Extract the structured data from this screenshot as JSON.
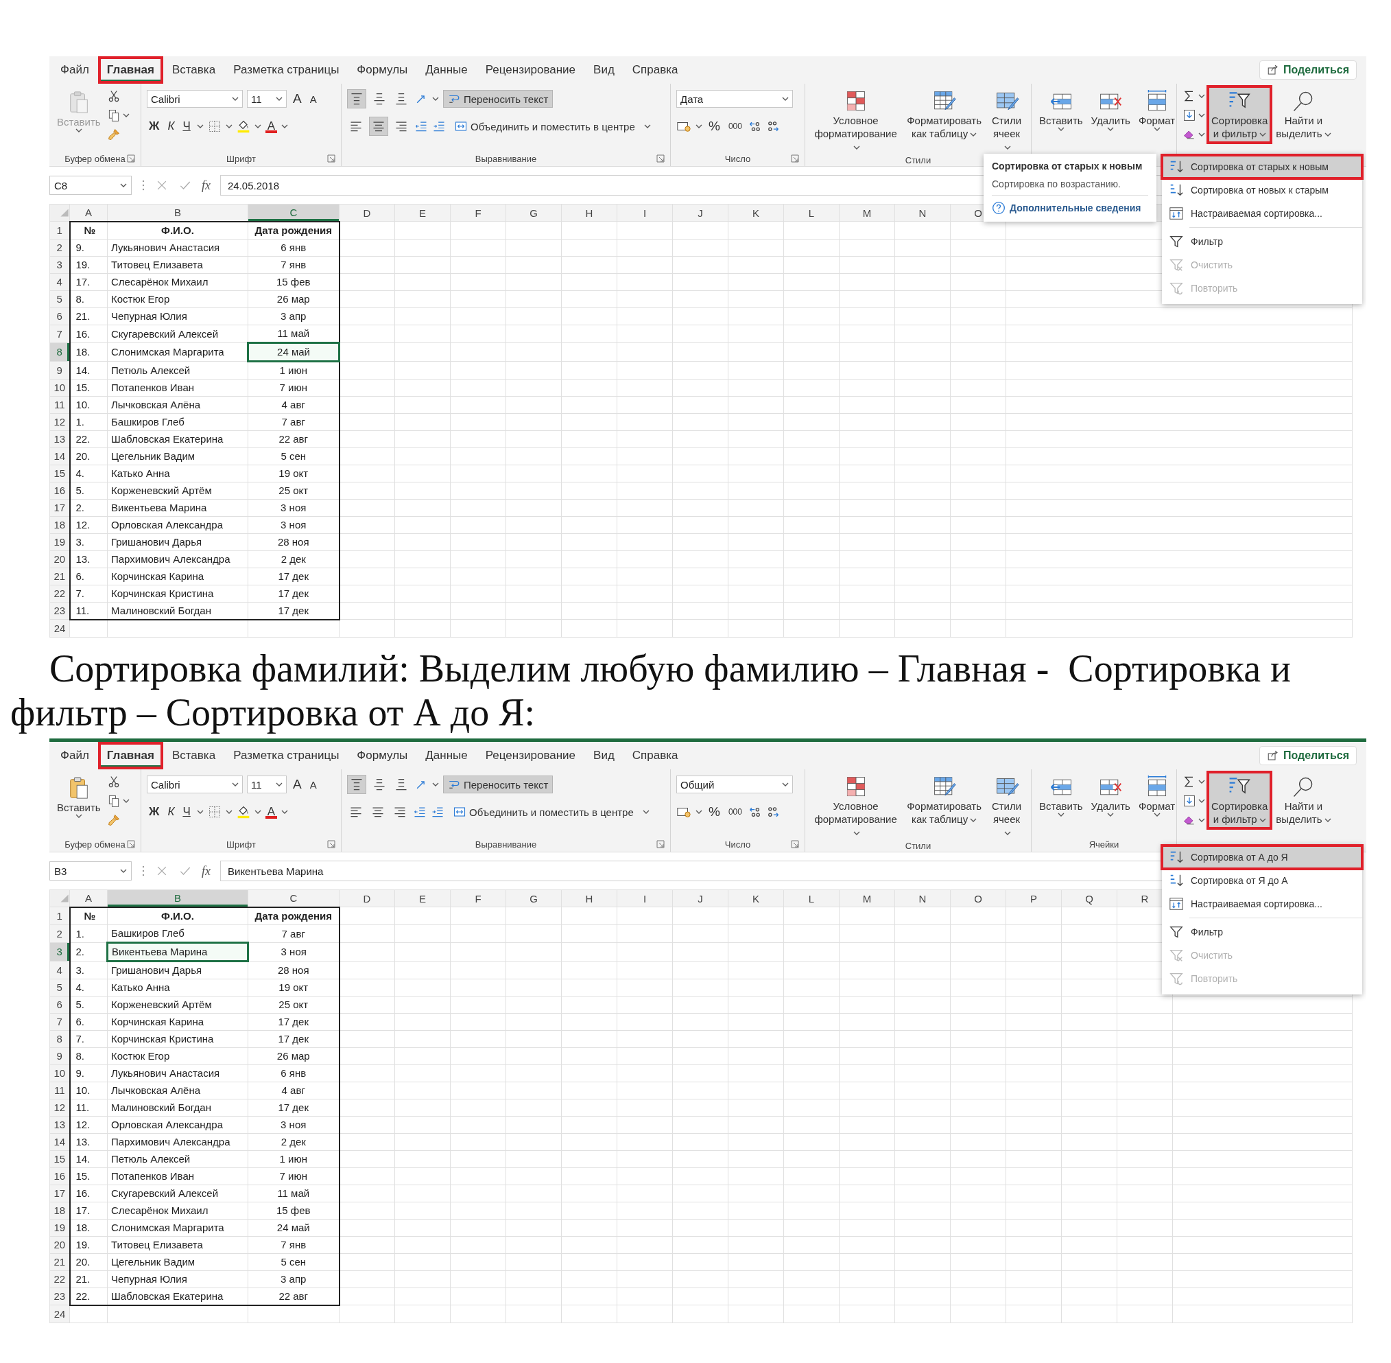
{
  "excel_top": {
    "tabs": [
      {
        "label": "Файл",
        "selected": false,
        "highlighted": false
      },
      {
        "label": "Главная",
        "selected": true,
        "highlighted": true
      },
      {
        "label": "Вставка",
        "selected": false,
        "highlighted": false
      },
      {
        "label": "Разметка страницы",
        "selected": false,
        "highlighted": false
      },
      {
        "label": "Формулы",
        "selected": false,
        "highlighted": false
      },
      {
        "label": "Данные",
        "selected": false,
        "highlighted": false
      },
      {
        "label": "Рецензирование",
        "selected": false,
        "highlighted": false
      },
      {
        "label": "Вид",
        "selected": false,
        "highlighted": false
      },
      {
        "label": "Справка",
        "selected": false,
        "highlighted": false
      }
    ],
    "share_button": "Поделиться",
    "ribbon": {
      "clipboard": {
        "paste": {
          "label": "Вставить",
          "disabled": true
        },
        "group_label": "Буфер обмена"
      },
      "font": {
        "font_name": "Calibri",
        "font_size": "11",
        "grow": "A",
        "shrink": "A",
        "bold": "Ж",
        "italic": "К",
        "underline": "Ч",
        "font_color": "A",
        "group_label": "Шрифт"
      },
      "alignment": {
        "vertical": [
          {
            "kind": "top",
            "pressed": true
          },
          {
            "kind": "middle",
            "pressed": false
          },
          {
            "kind": "bottom",
            "pressed": false
          }
        ],
        "horizontal": [
          {
            "kind": "left",
            "pressed": false
          },
          {
            "kind": "center",
            "pressed": true
          },
          {
            "kind": "right",
            "pressed": false
          }
        ],
        "wrap_text": {
          "label": "Переносить текст",
          "pressed": true
        },
        "merge": "Объединить и поместить в центре",
        "group_label": "Выравнивание"
      },
      "number": {
        "format": "Дата",
        "percent": "%",
        "thousands": "000",
        "group_label": "Число"
      },
      "styles": {
        "buttons": [
          {
            "kind": "conditional",
            "label": "Условное\nформатирование"
          },
          {
            "kind": "table",
            "label": "Форматировать\nкак таблицу"
          },
          {
            "kind": "cell-styles",
            "label": "Стили\nячеек"
          }
        ],
        "group_label": "Стили"
      },
      "cells": {
        "buttons": [
          {
            "kind": "insert",
            "label": "Вставить"
          },
          {
            "kind": "delete",
            "label": "Удалить"
          },
          {
            "kind": "format",
            "label": "Формат"
          }
        ]
      },
      "editing": {
        "sort_filter": {
          "label": "Сортировка\nи фильтр",
          "highlighted": true
        },
        "find": "Найти и\nвыделить"
      }
    },
    "formula_bar": {
      "name_box": "C8",
      "fx": "fx",
      "value": "24.05.2018"
    },
    "sheet": {
      "columns": [
        {
          "label": "A",
          "selected": false
        },
        {
          "label": "B",
          "selected": false
        },
        {
          "label": "C",
          "selected": true
        },
        {
          "label": "D",
          "selected": false
        },
        {
          "label": "E",
          "selected": false
        },
        {
          "label": "F",
          "selected": false
        },
        {
          "label": "G",
          "selected": false
        },
        {
          "label": "H",
          "selected": false
        },
        {
          "label": "I",
          "selected": false
        },
        {
          "label": "J",
          "selected": false
        },
        {
          "label": "K",
          "selected": false
        },
        {
          "label": "L",
          "selected": false
        },
        {
          "label": "M",
          "selected": false
        },
        {
          "label": "N",
          "selected": false
        },
        {
          "label": "O",
          "selected": false
        }
      ],
      "rows": [
        {
          "header": "1",
          "selected": false,
          "kind": "header",
          "cells": [
            {
              "text": "№",
              "active": false
            },
            {
              "text": "Ф.И.О.",
              "active": false
            },
            {
              "text": "Дата рождения",
              "active": false
            }
          ]
        },
        {
          "header": "2",
          "selected": false,
          "kind": "data",
          "cells": [
            {
              "text": "9.",
              "active": false
            },
            {
              "text": "Лукьянович Анастасия",
              "active": false
            },
            {
              "text": "6 янв",
              "active": false
            }
          ]
        },
        {
          "header": "3",
          "selected": false,
          "kind": "data",
          "cells": [
            {
              "text": "19.",
              "active": false
            },
            {
              "text": "Титовец Елизавета",
              "active": false
            },
            {
              "text": "7 янв",
              "active": false
            }
          ]
        },
        {
          "header": "4",
          "selected": false,
          "kind": "data",
          "cells": [
            {
              "text": "17.",
              "active": false
            },
            {
              "text": "Слесарёнок Михаил",
              "active": false
            },
            {
              "text": "15 фев",
              "active": false
            }
          ]
        },
        {
          "header": "5",
          "selected": false,
          "kind": "data",
          "cells": [
            {
              "text": "8.",
              "active": false
            },
            {
              "text": "Костюк Егор",
              "active": false
            },
            {
              "text": "26 мар",
              "active": false
            }
          ]
        },
        {
          "header": "6",
          "selected": false,
          "kind": "data",
          "cells": [
            {
              "text": "21.",
              "active": false
            },
            {
              "text": "Чепурная Юлия",
              "active": false
            },
            {
              "text": "3 апр",
              "active": false
            }
          ]
        },
        {
          "header": "7",
          "selected": false,
          "kind": "data",
          "cells": [
            {
              "text": "16.",
              "active": false
            },
            {
              "text": "Скугаревский Алексей",
              "active": false
            },
            {
              "text": "11 май",
              "active": false
            }
          ]
        },
        {
          "header": "8",
          "selected": true,
          "kind": "data",
          "cells": [
            {
              "text": "18.",
              "active": false
            },
            {
              "text": "Слонимская Маргарита",
              "active": false
            },
            {
              "text": "24 май",
              "active": true
            }
          ]
        },
        {
          "header": "9",
          "selected": false,
          "kind": "data",
          "cells": [
            {
              "text": "14.",
              "active": false
            },
            {
              "text": "Петюль Алексей",
              "active": false
            },
            {
              "text": "1 июн",
              "active": false
            }
          ]
        },
        {
          "header": "10",
          "selected": false,
          "kind": "data",
          "cells": [
            {
              "text": "15.",
              "active": false
            },
            {
              "text": "Потапенков Иван",
              "active": false
            },
            {
              "text": "7 июн",
              "active": false
            }
          ]
        },
        {
          "header": "11",
          "selected": false,
          "kind": "data",
          "cells": [
            {
              "text": "10.",
              "active": false
            },
            {
              "text": "Лычковская Алёна",
              "active": false
            },
            {
              "text": "4 авг",
              "active": false
            }
          ]
        },
        {
          "header": "12",
          "selected": false,
          "kind": "data",
          "cells": [
            {
              "text": "1.",
              "active": false
            },
            {
              "text": "Башкиров Глеб",
              "active": false
            },
            {
              "text": "7 авг",
              "active": false
            }
          ]
        },
        {
          "header": "13",
          "selected": false,
          "kind": "data",
          "cells": [
            {
              "text": "22.",
              "active": false
            },
            {
              "text": "Шабловская Екатерина",
              "active": false
            },
            {
              "text": "22 авг",
              "active": false
            }
          ]
        },
        {
          "header": "14",
          "selected": false,
          "kind": "data",
          "cells": [
            {
              "text": "20.",
              "active": false
            },
            {
              "text": "Цегельник Вадим",
              "active": false
            },
            {
              "text": "5 сен",
              "active": false
            }
          ]
        },
        {
          "header": "15",
          "selected": false,
          "kind": "data",
          "cells": [
            {
              "text": "4.",
              "active": false
            },
            {
              "text": "Катько Анна",
              "active": false
            },
            {
              "text": "19 окт",
              "active": false
            }
          ]
        },
        {
          "header": "16",
          "selected": false,
          "kind": "data",
          "cells": [
            {
              "text": "5.",
              "active": false
            },
            {
              "text": "Корженевский Артём",
              "active": false
            },
            {
              "text": "25 окт",
              "active": false
            }
          ]
        },
        {
          "header": "17",
          "selected": false,
          "kind": "data",
          "cells": [
            {
              "text": "2.",
              "active": false
            },
            {
              "text": "Викентьева Марина",
              "active": false
            },
            {
              "text": "3 ноя",
              "active": false
            }
          ]
        },
        {
          "header": "18",
          "selected": false,
          "kind": "data",
          "cells": [
            {
              "text": "12.",
              "active": false
            },
            {
              "text": "Орловская Александра",
              "active": false
            },
            {
              "text": "3 ноя",
              "active": false
            }
          ]
        },
        {
          "header": "19",
          "selected": false,
          "kind": "data",
          "cells": [
            {
              "text": "3.",
              "active": false
            },
            {
              "text": "Гришанович Дарья",
              "active": false
            },
            {
              "text": "28 ноя",
              "active": false
            }
          ]
        },
        {
          "header": "20",
          "selected": false,
          "kind": "data",
          "cells": [
            {
              "text": "13.",
              "active": false
            },
            {
              "text": "Пархимович Александра",
              "active": false
            },
            {
              "text": "2 дек",
              "active": false
            }
          ]
        },
        {
          "header": "21",
          "selected": false,
          "kind": "data",
          "cells": [
            {
              "text": "6.",
              "active": false
            },
            {
              "text": "Корчинская Карина",
              "active": false
            },
            {
              "text": "17 дек",
              "active": false
            }
          ]
        },
        {
          "header": "22",
          "selected": false,
          "kind": "data",
          "cells": [
            {
              "text": "7.",
              "active": false
            },
            {
              "text": "Корчинская Кристина",
              "active": false
            },
            {
              "text": "17 дек",
              "active": false
            }
          ]
        },
        {
          "header": "23",
          "selected": false,
          "kind": "data",
          "cells": [
            {
              "text": "11.",
              "active": false
            },
            {
              "text": "Малиновский Богдан",
              "active": false
            },
            {
              "text": "17 дек",
              "active": false
            }
          ]
        },
        {
          "header": "24",
          "selected": false,
          "kind": "data",
          "cells": []
        }
      ]
    },
    "tooltip": {
      "title": "Сортировка от старых к новым",
      "description": "Сортировка по возрастанию.",
      "link": "Дополнительные сведения"
    },
    "sort_menu": {
      "items": [
        {
          "kind": "sort-asc",
          "label": "Сортировка от старых к новым",
          "highlighted": true,
          "disabled": false
        },
        {
          "kind": "sort-desc",
          "label": "Сортировка от новых к старым",
          "highlighted": false,
          "disabled": false
        },
        {
          "kind": "custom-sort",
          "label": "Настраиваемая сортировка...",
          "highlighted": false,
          "disabled": false
        },
        {
          "kind": "filter",
          "label": "Фильтр",
          "highlighted": false,
          "disabled": false
        },
        {
          "kind": "clear",
          "label": "Очистить",
          "highlighted": false,
          "disabled": true
        },
        {
          "kind": "reapply",
          "label": "Повторить",
          "highlighted": false,
          "disabled": true
        }
      ]
    }
  },
  "caption": "Сортировка фамилий: Выделим любую фамилию – Главная -  Сортировка и фильтр – Сортировка от А до Я:",
  "excel_bottom": {
    "tabs": [
      {
        "label": "Файл",
        "selected": false,
        "highlighted": false
      },
      {
        "label": "Главная",
        "selected": true,
        "highlighted": true
      },
      {
        "label": "Вставка",
        "selected": false,
        "highlighted": false
      },
      {
        "label": "Разметка страницы",
        "selected": false,
        "highlighted": false
      },
      {
        "label": "Формулы",
        "selected": false,
        "highlighted": false
      },
      {
        "label": "Данные",
        "selected": false,
        "highlighted": false
      },
      {
        "label": "Рецензирование",
        "selected": false,
        "highlighted": false
      },
      {
        "label": "Вид",
        "selected": false,
        "highlighted": false
      },
      {
        "label": "Справка",
        "selected": false,
        "highlighted": false
      }
    ],
    "share_button": "Поделиться",
    "ribbon": {
      "clipboard": {
        "paste": {
          "label": "Вставить",
          "disabled": false
        },
        "group_label": "Буфер обмена"
      },
      "font": {
        "font_name": "Calibri",
        "font_size": "11",
        "grow": "A",
        "shrink": "A",
        "bold": "Ж",
        "italic": "К",
        "underline": "Ч",
        "font_color": "A",
        "group_label": "Шрифт"
      },
      "alignment": {
        "vertical": [
          {
            "kind": "top",
            "pressed": true
          },
          {
            "kind": "middle",
            "pressed": false
          },
          {
            "kind": "bottom",
            "pressed": false
          }
        ],
        "horizontal": [
          {
            "kind": "left",
            "pressed": false
          },
          {
            "kind": "center",
            "pressed": false
          },
          {
            "kind": "right",
            "pressed": false
          }
        ],
        "wrap_text": {
          "label": "Переносить текст",
          "pressed": true
        },
        "merge": "Объединить и поместить в центре",
        "group_label": "Выравнивание"
      },
      "number": {
        "format": "Общий",
        "percent": "%",
        "thousands": "000",
        "group_label": "Число"
      },
      "styles": {
        "buttons": [
          {
            "kind": "conditional",
            "label": "Условное\nформатирование"
          },
          {
            "kind": "table",
            "label": "Форматировать\nкак таблицу"
          },
          {
            "kind": "cell-styles",
            "label": "Стили\nячеек"
          }
        ],
        "group_label": "Стили"
      },
      "cells": {
        "buttons": [
          {
            "kind": "insert",
            "label": "Вставить"
          },
          {
            "kind": "delete",
            "label": "Удалить"
          },
          {
            "kind": "format",
            "label": "Формат"
          }
        ],
        "group_label": "Ячейки"
      },
      "editing": {
        "sort_filter": {
          "label": "Сортировка\nи фильтр",
          "highlighted": true
        },
        "find": "Найти и\nвыделить"
      }
    },
    "formula_bar": {
      "name_box": "B3",
      "fx": "fx",
      "value": "Викентьева Марина"
    },
    "sheet": {
      "columns": [
        {
          "label": "A",
          "selected": false
        },
        {
          "label": "B",
          "selected": true
        },
        {
          "label": "C",
          "selected": false
        },
        {
          "label": "D",
          "selected": false
        },
        {
          "label": "E",
          "selected": false
        },
        {
          "label": "F",
          "selected": false
        },
        {
          "label": "G",
          "selected": false
        },
        {
          "label": "H",
          "selected": false
        },
        {
          "label": "I",
          "selected": false
        },
        {
          "label": "J",
          "selected": false
        },
        {
          "label": "K",
          "selected": false
        },
        {
          "label": "L",
          "selected": false
        },
        {
          "label": "M",
          "selected": false
        },
        {
          "label": "N",
          "selected": false
        },
        {
          "label": "O",
          "selected": false
        },
        {
          "label": "P",
          "selected": false
        },
        {
          "label": "Q",
          "selected": false
        },
        {
          "label": "R",
          "selected": false
        }
      ],
      "rows": [
        {
          "header": "1",
          "selected": false,
          "kind": "header",
          "cells": [
            {
              "text": "№",
              "active": false
            },
            {
              "text": "Ф.И.О.",
              "active": false
            },
            {
              "text": "Дата рождения",
              "active": false
            }
          ]
        },
        {
          "header": "2",
          "selected": false,
          "kind": "data",
          "cells": [
            {
              "text": "1.",
              "active": false
            },
            {
              "text": "Башкиров Глеб",
              "active": false
            },
            {
              "text": "7 авг",
              "active": false
            }
          ]
        },
        {
          "header": "3",
          "selected": true,
          "kind": "data",
          "cells": [
            {
              "text": "2.",
              "active": false
            },
            {
              "text": "Викентьева Марина",
              "active": true
            },
            {
              "text": "3 ноя",
              "active": false
            }
          ]
        },
        {
          "header": "4",
          "selected": false,
          "kind": "data",
          "cells": [
            {
              "text": "3.",
              "active": false
            },
            {
              "text": "Гришанович Дарья",
              "active": false
            },
            {
              "text": "28 ноя",
              "active": false
            }
          ]
        },
        {
          "header": "5",
          "selected": false,
          "kind": "data",
          "cells": [
            {
              "text": "4.",
              "active": false
            },
            {
              "text": "Катько Анна",
              "active": false
            },
            {
              "text": "19 окт",
              "active": false
            }
          ]
        },
        {
          "header": "6",
          "selected": false,
          "kind": "data",
          "cells": [
            {
              "text": "5.",
              "active": false
            },
            {
              "text": "Корженевский Артём",
              "active": false
            },
            {
              "text": "25 окт",
              "active": false
            }
          ]
        },
        {
          "header": "7",
          "selected": false,
          "kind": "data",
          "cells": [
            {
              "text": "6.",
              "active": false
            },
            {
              "text": "Корчинская Карина",
              "active": false
            },
            {
              "text": "17 дек",
              "active": false
            }
          ]
        },
        {
          "header": "8",
          "selected": false,
          "kind": "data",
          "cells": [
            {
              "text": "7.",
              "active": false
            },
            {
              "text": "Корчинская Кристина",
              "active": false
            },
            {
              "text": "17 дек",
              "active": false
            }
          ]
        },
        {
          "header": "9",
          "selected": false,
          "kind": "data",
          "cells": [
            {
              "text": "8.",
              "active": false
            },
            {
              "text": "Костюк Егор",
              "active": false
            },
            {
              "text": "26 мар",
              "active": false
            }
          ]
        },
        {
          "header": "10",
          "selected": false,
          "kind": "data",
          "cells": [
            {
              "text": "9.",
              "active": false
            },
            {
              "text": "Лукьянович Анастасия",
              "active": false
            },
            {
              "text": "6 янв",
              "active": false
            }
          ]
        },
        {
          "header": "11",
          "selected": false,
          "kind": "data",
          "cells": [
            {
              "text": "10.",
              "active": false
            },
            {
              "text": "Лычковская Алёна",
              "active": false
            },
            {
              "text": "4 авг",
              "active": false
            }
          ]
        },
        {
          "header": "12",
          "selected": false,
          "kind": "data",
          "cells": [
            {
              "text": "11.",
              "active": false
            },
            {
              "text": "Малиновский Богдан",
              "active": false
            },
            {
              "text": "17 дек",
              "active": false
            }
          ]
        },
        {
          "header": "13",
          "selected": false,
          "kind": "data",
          "cells": [
            {
              "text": "12.",
              "active": false
            },
            {
              "text": "Орловская Александра",
              "active": false
            },
            {
              "text": "3 ноя",
              "active": false
            }
          ]
        },
        {
          "header": "14",
          "selected": false,
          "kind": "data",
          "cells": [
            {
              "text": "13.",
              "active": false
            },
            {
              "text": "Пархимович Александра",
              "active": false
            },
            {
              "text": "2 дек",
              "active": false
            }
          ]
        },
        {
          "header": "15",
          "selected": false,
          "kind": "data",
          "cells": [
            {
              "text": "14.",
              "active": false
            },
            {
              "text": "Петюль Алексей",
              "active": false
            },
            {
              "text": "1 июн",
              "active": false
            }
          ]
        },
        {
          "header": "16",
          "selected": false,
          "kind": "data",
          "cells": [
            {
              "text": "15.",
              "active": false
            },
            {
              "text": "Потапенков Иван",
              "active": false
            },
            {
              "text": "7 июн",
              "active": false
            }
          ]
        },
        {
          "header": "17",
          "selected": false,
          "kind": "data",
          "cells": [
            {
              "text": "16.",
              "active": false
            },
            {
              "text": "Скугаревский Алексей",
              "active": false
            },
            {
              "text": "11 май",
              "active": false
            }
          ]
        },
        {
          "header": "18",
          "selected": false,
          "kind": "data",
          "cells": [
            {
              "text": "17.",
              "active": false
            },
            {
              "text": "Слесарёнок Михаил",
              "active": false
            },
            {
              "text": "15 фев",
              "active": false
            }
          ]
        },
        {
          "header": "19",
          "selected": false,
          "kind": "data",
          "cells": [
            {
              "text": "18.",
              "active": false
            },
            {
              "text": "Слонимская Маргарита",
              "active": false
            },
            {
              "text": "24 май",
              "active": false
            }
          ]
        },
        {
          "header": "20",
          "selected": false,
          "kind": "data",
          "cells": [
            {
              "text": "19.",
              "active": false
            },
            {
              "text": "Титовец Елизавета",
              "active": false
            },
            {
              "text": "7 янв",
              "active": false
            }
          ]
        },
        {
          "header": "21",
          "selected": false,
          "kind": "data",
          "cells": [
            {
              "text": "20.",
              "active": false
            },
            {
              "text": "Цегельник Вадим",
              "active": false
            },
            {
              "text": "5 сен",
              "active": false
            }
          ]
        },
        {
          "header": "22",
          "selected": false,
          "kind": "data",
          "cells": [
            {
              "text": "21.",
              "active": false
            },
            {
              "text": "Чепурная Юлия",
              "active": false
            },
            {
              "text": "3 апр",
              "active": false
            }
          ]
        },
        {
          "header": "23",
          "selected": false,
          "kind": "data",
          "cells": [
            {
              "text": "22.",
              "active": false
            },
            {
              "text": "Шабловская Екатерина",
              "active": false
            },
            {
              "text": "22 авг",
              "active": false
            }
          ]
        },
        {
          "header": "24",
          "selected": false,
          "kind": "data",
          "cells": []
        }
      ]
    },
    "sort_menu": {
      "items": [
        {
          "kind": "sort-asc",
          "label": "Сортировка от А до Я",
          "highlighted": true,
          "disabled": false
        },
        {
          "kind": "sort-desc",
          "label": "Сортировка от Я до А",
          "highlighted": false,
          "disabled": false
        },
        {
          "kind": "custom-sort",
          "label": "Настраиваемая сортировка...",
          "highlighted": false,
          "disabled": false
        },
        {
          "kind": "filter",
          "label": "Фильтр",
          "highlighted": false,
          "disabled": false
        },
        {
          "kind": "clear",
          "label": "Очистить",
          "highlighted": false,
          "disabled": true
        },
        {
          "kind": "reapply",
          "label": "Повторить",
          "highlighted": false,
          "disabled": true
        }
      ]
    }
  }
}
